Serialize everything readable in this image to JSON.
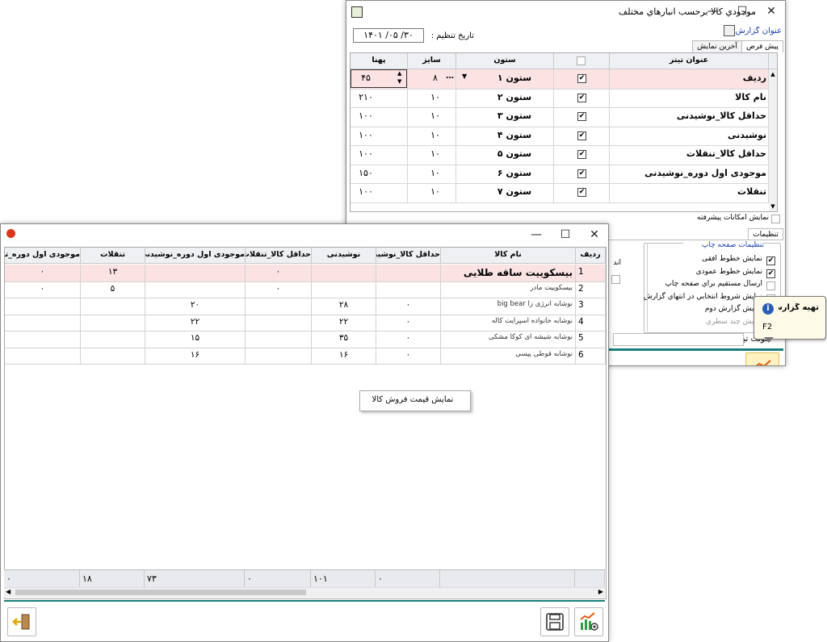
{
  "back_window": {
    "title": "موجودي کالا برحسب انبارهاي مختلف",
    "report_title_label": "عنوان گزارش :",
    "date_label": "تاریخ تنظیم :",
    "date_value": "۱۴۰۱ /۰۵ /۳۰",
    "tabs": [
      "پیش فرض",
      "آخرین نمایش"
    ],
    "columns": [
      "عنوان تیتر",
      "ستون",
      "سایز",
      "پهنا"
    ],
    "rows": [
      {
        "title": "ردیف",
        "column": "ستون ۱",
        "checked": true,
        "size": "۸",
        "width": "۴۵",
        "selected": true
      },
      {
        "title": "نام کالا",
        "column": "ستون ۲",
        "checked": true,
        "size": "۱۰",
        "width": "۲۱۰"
      },
      {
        "title": "حداقل کالا_نوشیدنی",
        "column": "ستون ۳",
        "checked": true,
        "size": "۱۰",
        "width": "۱۰۰"
      },
      {
        "title": "نوشیدنی",
        "column": "ستون ۴",
        "checked": true,
        "size": "۱۰",
        "width": "۱۰۰"
      },
      {
        "title": "حداقل کالا_تنقلات",
        "column": "ستون ۵",
        "checked": true,
        "size": "۱۰",
        "width": "۱۰۰"
      },
      {
        "title": "موجودی اول دوره_نوشیدنی",
        "column": "ستون ۶",
        "checked": true,
        "size": "۱۰",
        "width": "۱۵۰"
      },
      {
        "title": "تنقلات",
        "column": "ستون ۷",
        "checked": true,
        "size": "۱۰",
        "width": "۱۰۰"
      }
    ],
    "advanced_label": "نمایش امکانات پیشرفته",
    "settings_tab": "تنظیمات",
    "print_group_title": "تنظیمات صفحه چاپ",
    "print_options": [
      {
        "label": "نمایش خطوط افقی",
        "checked": true
      },
      {
        "label": "نمایش خطوط عمودی",
        "checked": true
      },
      {
        "label": "ارسال مستقیم براي صفحه چاپ",
        "checked": false
      },
      {
        "label": "نمایش شروط انتخابي در انتهاي گزارش",
        "checked": false
      },
      {
        "label": "نمایش گزارش دوم",
        "checked": false
      },
      {
        "label": "نمایش چند سطري",
        "checked": false
      }
    ],
    "title_font_label": "فونت تیتر :",
    "left_fragment": "اند"
  },
  "tooltip": {
    "title": "تهیه گزارش",
    "shortcut": "F2"
  },
  "front_window": {
    "columns": [
      "ردیف",
      "نام کالا",
      "حداقل کالا_نوشیدنی",
      "نوشیدنی",
      "حداقل کالا_تنقلات",
      "موجودی اول دوره_نوشیدنی",
      "تنقلات",
      "موجودی اول دوره_تن"
    ],
    "rows": [
      [
        "1",
        "بیسکوییت ساقه طلایی",
        "",
        "",
        "۰",
        "",
        "۱۳",
        "۰"
      ],
      [
        "2",
        "بیسکوییت مادر",
        "",
        "",
        "۰",
        "",
        "۵",
        "۰"
      ],
      [
        "3",
        "نوشابه انرژی زا big bear",
        "۰",
        "۲۸",
        "",
        "۲۰",
        "",
        ""
      ],
      [
        "4",
        "نوشابه خانواده اسپرایت کاله",
        "۰",
        "۲۲",
        "",
        "۲۲",
        "",
        ""
      ],
      [
        "5",
        "نوشابه شیشه ای کوکا مشکی",
        "۰",
        "۳۵",
        "",
        "۱۵",
        "",
        ""
      ],
      [
        "6",
        "نوشابه قوطی پپسی",
        "۰",
        "۱۶",
        "",
        "۱۶",
        "",
        ""
      ]
    ],
    "totals": [
      "",
      "",
      "۰",
      "۱۰۱",
      "۰",
      "۷۳",
      "۱۸",
      "۰"
    ],
    "context_menu_item": "نمایش قیمت فروش کالا"
  }
}
